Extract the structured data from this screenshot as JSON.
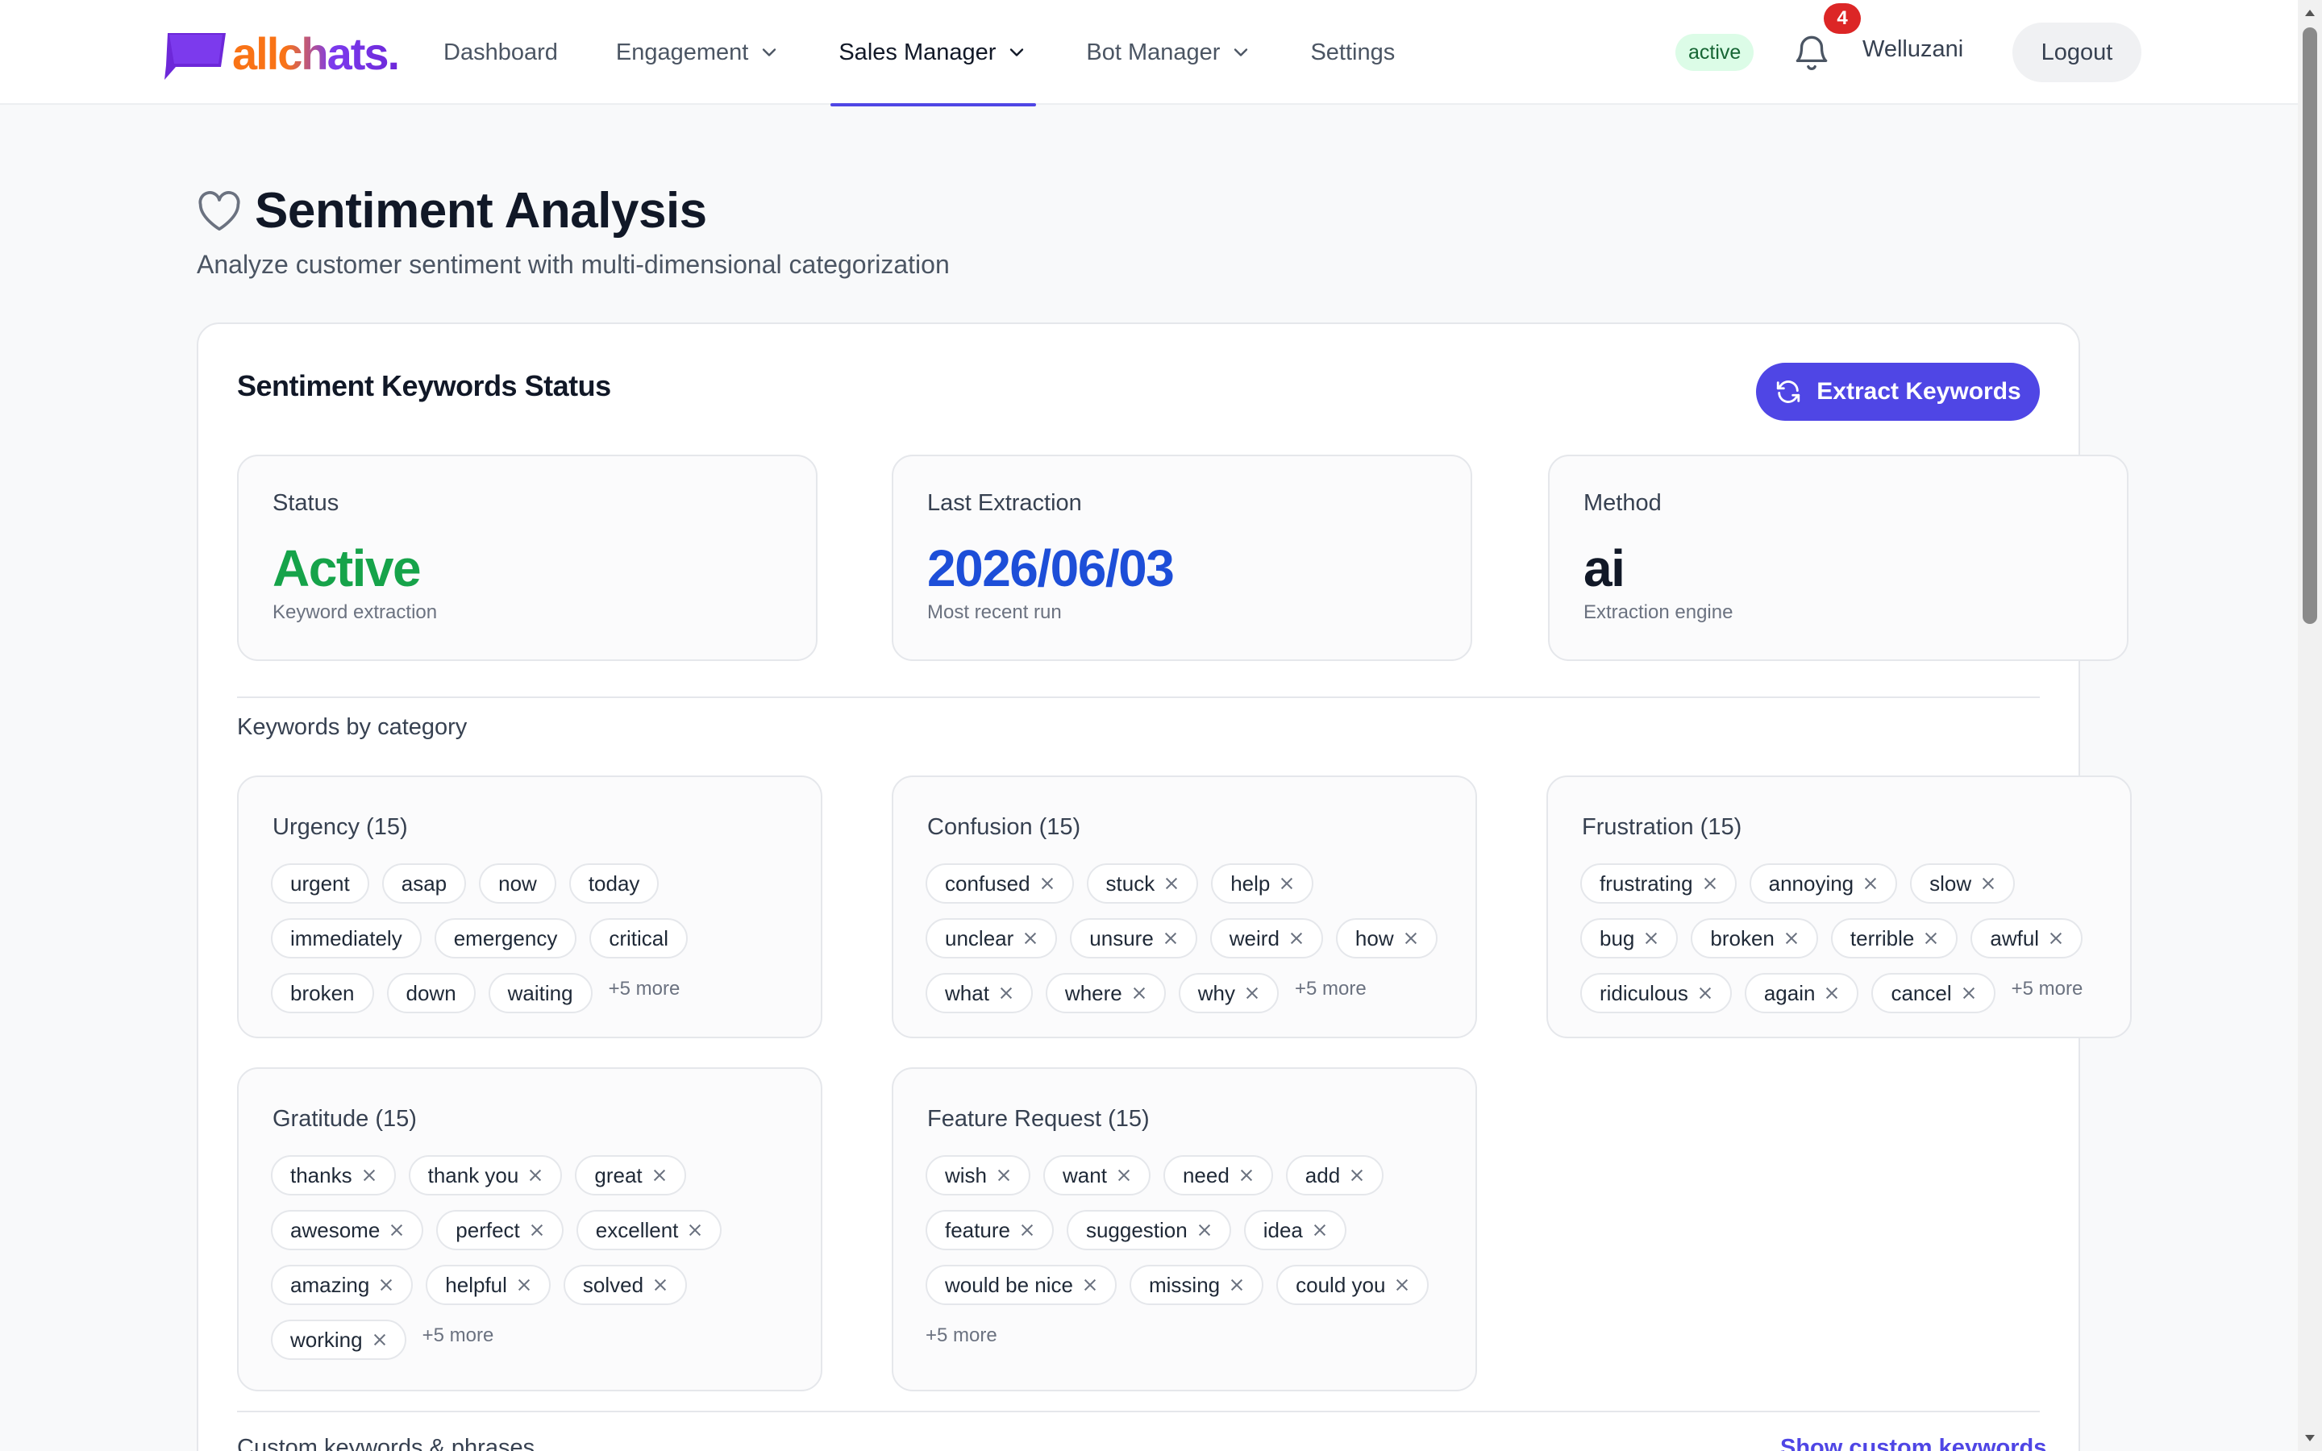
{
  "brand": {
    "logo_text": "allchats."
  },
  "nav": [
    {
      "label": "Dashboard",
      "dropdown": false,
      "active": false
    },
    {
      "label": "Engagement",
      "dropdown": true,
      "active": false
    },
    {
      "label": "Sales Manager",
      "dropdown": true,
      "active": true
    },
    {
      "label": "Bot Manager",
      "dropdown": true,
      "active": false
    },
    {
      "label": "Settings",
      "dropdown": false,
      "active": false
    }
  ],
  "header": {
    "status_badge": "active",
    "notification_count": "4",
    "username": "Welluzani",
    "logout_label": "Logout"
  },
  "page": {
    "title": "Sentiment Analysis",
    "subtitle": "Analyze customer sentiment with multi-dimensional categorization"
  },
  "card": {
    "title": "Sentiment Keywords Status",
    "extract_label": "Extract Keywords",
    "stats": [
      {
        "label": "Status",
        "value": "Active",
        "caption": "Keyword extraction",
        "color": "#16a34a"
      },
      {
        "label": "Last Extraction",
        "value": "2026/06/03",
        "caption": "Most recent run",
        "color": "#1d4ed8"
      },
      {
        "label": "Method",
        "value": "ai",
        "caption": "Extraction engine",
        "color": "#111827"
      }
    ],
    "section_label": "Keywords by category",
    "categories": [
      {
        "title": "Urgency (15)",
        "removable": false,
        "rows": [
          [
            "urgent",
            "asap",
            "now",
            "today"
          ],
          [
            "immediately",
            "emergency",
            "critical"
          ],
          [
            "broken",
            "down",
            "waiting"
          ]
        ],
        "more": "+5 more"
      },
      {
        "title": "Confusion (15)",
        "removable": true,
        "rows": [
          [
            "confused",
            "stuck",
            "help"
          ],
          [
            "unclear",
            "unsure",
            "weird",
            "how"
          ],
          [
            "what",
            "where",
            "why"
          ]
        ],
        "more": "+5 more"
      },
      {
        "title": "Frustration (15)",
        "removable": true,
        "rows": [
          [
            "frustrating",
            "annoying",
            "slow"
          ],
          [
            "bug",
            "broken",
            "terrible",
            "awful"
          ],
          [
            "ridiculous",
            "again",
            "cancel"
          ]
        ],
        "more": "+5 more"
      },
      {
        "title": "Gratitude (15)",
        "removable": true,
        "rows": [
          [
            "thanks",
            "thank you",
            "great"
          ],
          [
            "awesome",
            "perfect",
            "excellent"
          ],
          [
            "amazing",
            "helpful",
            "solved"
          ],
          [
            "working"
          ]
        ],
        "more": "+5 more"
      },
      {
        "title": "Feature Request (15)",
        "removable": true,
        "rows": [
          [
            "wish",
            "want",
            "need",
            "add"
          ],
          [
            "feature",
            "suggestion",
            "idea"
          ],
          [
            "would be nice",
            "missing",
            "could you"
          ]
        ],
        "more": "+5 more"
      }
    ],
    "custom_label": "Custom keywords & phrases",
    "show_custom_label": "Show custom keywords"
  },
  "colors": {
    "accent": "#4f46e5",
    "success": "#16a34a",
    "date": "#1d4ed8",
    "notification": "#dc2626"
  },
  "icons": {
    "title": "heart-icon",
    "extract": "refresh-icon",
    "notification": "bell-icon",
    "dropdown": "chevron-down-icon",
    "chip_remove": "close-icon"
  }
}
